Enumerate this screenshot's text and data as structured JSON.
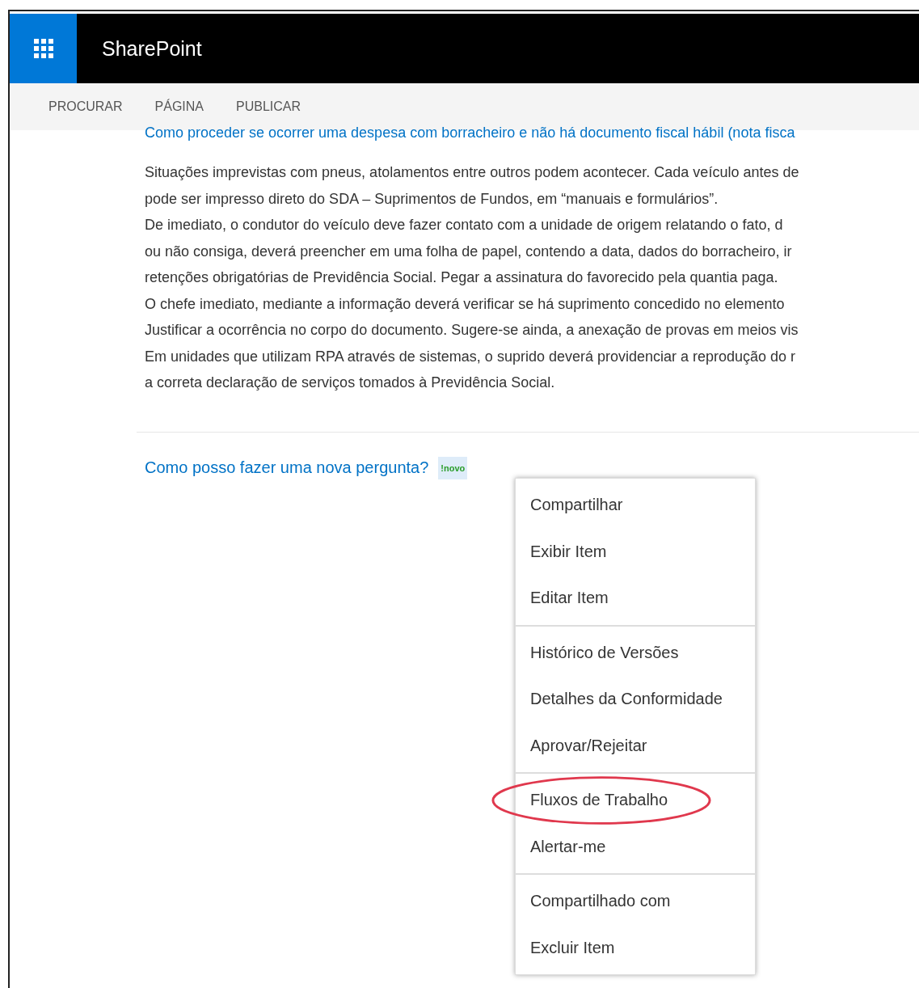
{
  "header": {
    "app_title": "SharePoint"
  },
  "ribbon_tabs": [
    {
      "label": "PROCURAR",
      "selected": false
    },
    {
      "label": "PÁGINA",
      "selected": false
    },
    {
      "label": "PUBLICAR",
      "selected": false
    }
  ],
  "article": {
    "title": "Como proceder se ocorrer uma despesa com borracheiro e não há documento fiscal hábil (nota fisca",
    "lines": [
      "Situações imprevistas com pneus, atolamentos entre outros podem acontecer. Cada veículo antes de",
      "pode ser impresso direto do SDA – Suprimentos de Fundos, em “manuais e formulários”.",
      "De imediato, o condutor do veículo deve fazer contato com a unidade de origem relatando o fato, d",
      "ou não consiga, deverá preencher em uma folha de papel, contendo a data, dados do borracheiro, ir",
      "retenções obrigatórias de Previdência Social. Pegar a assinatura do favorecido pela quantia paga.",
      "O chefe imediato, mediante a informação deverá verificar se há suprimento concedido no elemento",
      "Justificar a ocorrência no corpo do documento. Sugere-se ainda, a anexação de provas em meios vis",
      "Em unidades que utilizam RPA através de sistemas, o suprido deverá providenciar a reprodução do r",
      "a correta declaração de serviços tomados à Previdência Social."
    ]
  },
  "question": {
    "title": "Como posso fazer uma nova pergunta?",
    "badge": "!novo"
  },
  "context_menu": [
    [
      {
        "label": "Compartilhar",
        "highlighted": false
      },
      {
        "label": "Exibir Item",
        "highlighted": false
      },
      {
        "label": "Editar Item",
        "highlighted": false
      }
    ],
    [
      {
        "label": "Histórico de Versões",
        "highlighted": false
      },
      {
        "label": "Detalhes da Conformidade",
        "highlighted": false
      },
      {
        "label": "Aprovar/Rejeitar",
        "highlighted": false
      }
    ],
    [
      {
        "label": "Fluxos de Trabalho",
        "highlighted": true
      },
      {
        "label": "Alertar-me",
        "highlighted": false
      }
    ],
    [
      {
        "label": "Compartilhado com",
        "highlighted": false
      },
      {
        "label": "Excluir Item",
        "highlighted": false
      }
    ]
  ]
}
